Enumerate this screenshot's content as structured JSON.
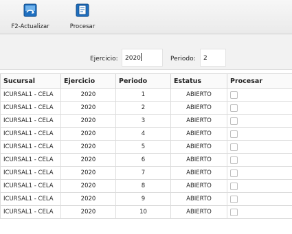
{
  "toolbar": {
    "refresh_label": "F2-Actualizar",
    "process_label": "Procesar"
  },
  "filter": {
    "ejercicio_label": "Ejercicio:",
    "ejercicio_value": "2020",
    "periodo_label": "Periodo:",
    "periodo_value": "2"
  },
  "table": {
    "headers": [
      "Sucursal",
      "Ejercicio",
      "Periodo",
      "Estatus",
      "Procesar"
    ],
    "rows": [
      {
        "sucursal": "ICURSAL1 - CELA",
        "ejercicio": "2020",
        "periodo": "1",
        "estatus": "ABIERTO"
      },
      {
        "sucursal": "ICURSAL1 - CELA",
        "ejercicio": "2020",
        "periodo": "2",
        "estatus": "ABIERTO"
      },
      {
        "sucursal": "ICURSAL1 - CELA",
        "ejercicio": "2020",
        "periodo": "3",
        "estatus": "ABIERTO"
      },
      {
        "sucursal": "ICURSAL1 - CELA",
        "ejercicio": "2020",
        "periodo": "4",
        "estatus": "ABIERTO"
      },
      {
        "sucursal": "ICURSAL1 - CELA",
        "ejercicio": "2020",
        "periodo": "5",
        "estatus": "ABIERTO"
      },
      {
        "sucursal": "ICURSAL1 - CELA",
        "ejercicio": "2020",
        "periodo": "6",
        "estatus": "ABIERTO"
      },
      {
        "sucursal": "ICURSAL1 - CELA",
        "ejercicio": "2020",
        "periodo": "7",
        "estatus": "ABIERTO"
      },
      {
        "sucursal": "ICURSAL1 - CELA",
        "ejercicio": "2020",
        "periodo": "8",
        "estatus": "ABIERTO"
      },
      {
        "sucursal": "ICURSAL1 - CELA",
        "ejercicio": "2020",
        "periodo": "9",
        "estatus": "ABIERTO"
      },
      {
        "sucursal": "ICURSAL1 - CELA",
        "ejercicio": "2020",
        "periodo": "10",
        "estatus": "ABIERTO"
      }
    ]
  },
  "icons": {
    "refresh": "refresh-icon",
    "process": "process-document-icon"
  },
  "colors": {
    "icon_blue": "#1e6fc0",
    "header_bg": "#fafafa",
    "filter_bg": "#f2f2f2"
  }
}
